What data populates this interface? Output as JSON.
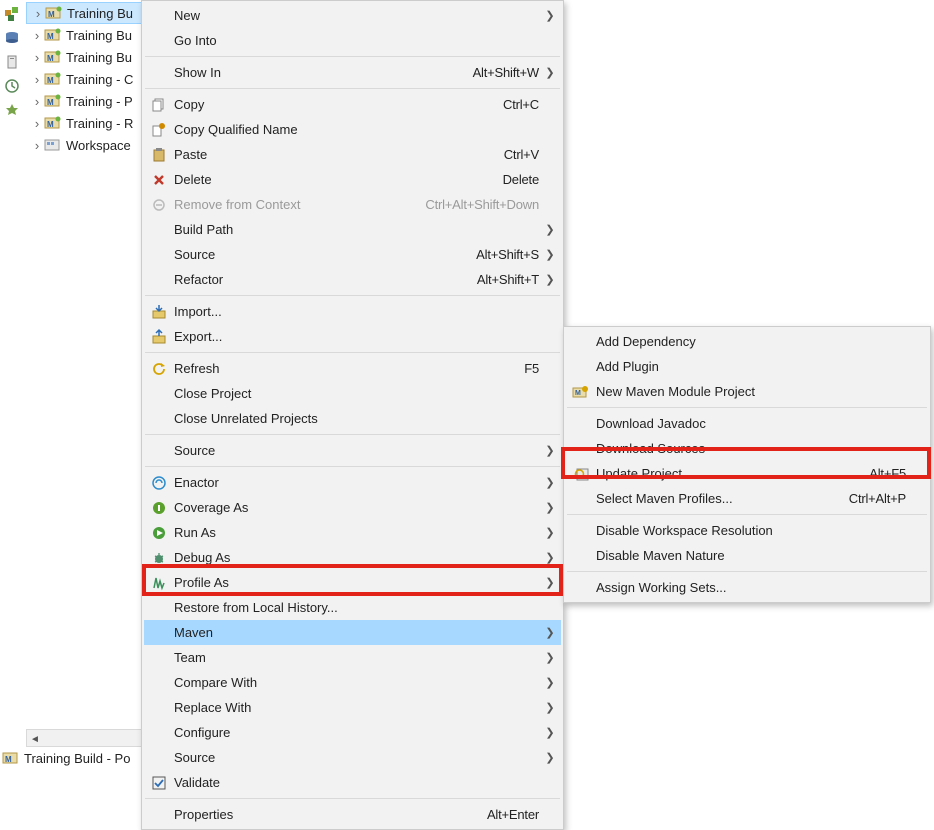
{
  "vstrip_icons": [
    "package-icon",
    "db-icon",
    "tag-icon",
    "history-icon",
    "star-icon"
  ],
  "tree": [
    {
      "label": "Training Bu",
      "selected": true
    },
    {
      "label": "Training Bu",
      "selected": false
    },
    {
      "label": "Training Bu",
      "selected": false
    },
    {
      "label": "Training - C",
      "selected": false
    },
    {
      "label": "Training - P",
      "selected": false
    },
    {
      "label": "Training - R",
      "selected": false
    },
    {
      "label": "Workspace",
      "selected": false
    }
  ],
  "status_text": "Training Build - Po",
  "menu1": {
    "groups": [
      [
        {
          "icon": null,
          "label": "New",
          "shortcut": "",
          "arrow": true
        },
        {
          "icon": null,
          "label": "Go Into",
          "shortcut": "",
          "arrow": false
        }
      ],
      [
        {
          "icon": null,
          "label": "Show In",
          "shortcut": "Alt+Shift+W",
          "arrow": true
        }
      ],
      [
        {
          "icon": "copy-icon",
          "label": "Copy",
          "shortcut": "Ctrl+C",
          "arrow": false
        },
        {
          "icon": "copy-qualified-icon",
          "label": "Copy Qualified Name",
          "shortcut": "",
          "arrow": false
        },
        {
          "icon": "paste-icon",
          "label": "Paste",
          "shortcut": "Ctrl+V",
          "arrow": false
        },
        {
          "icon": "delete-icon",
          "label": "Delete",
          "shortcut": "Delete",
          "arrow": false
        },
        {
          "icon": "context-icon",
          "label": "Remove from Context",
          "shortcut": "Ctrl+Alt+Shift+Down",
          "arrow": false,
          "disabled": true
        },
        {
          "icon": null,
          "label": "Build Path",
          "shortcut": "",
          "arrow": true
        },
        {
          "icon": null,
          "label": "Source",
          "shortcut": "Alt+Shift+S",
          "arrow": true
        },
        {
          "icon": null,
          "label": "Refactor",
          "shortcut": "Alt+Shift+T",
          "arrow": true
        }
      ],
      [
        {
          "icon": "import-icon",
          "label": "Import...",
          "shortcut": "",
          "arrow": false
        },
        {
          "icon": "export-icon",
          "label": "Export...",
          "shortcut": "",
          "arrow": false
        }
      ],
      [
        {
          "icon": "refresh-icon",
          "label": "Refresh",
          "shortcut": "F5",
          "arrow": false
        },
        {
          "icon": null,
          "label": "Close Project",
          "shortcut": "",
          "arrow": false
        },
        {
          "icon": null,
          "label": "Close Unrelated Projects",
          "shortcut": "",
          "arrow": false
        }
      ],
      [
        {
          "icon": null,
          "label": "Source",
          "shortcut": "",
          "arrow": true
        }
      ],
      [
        {
          "icon": "enactor-icon",
          "label": "Enactor",
          "shortcut": "",
          "arrow": true
        },
        {
          "icon": "coverage-icon",
          "label": "Coverage As",
          "shortcut": "",
          "arrow": true
        },
        {
          "icon": "run-icon",
          "label": "Run As",
          "shortcut": "",
          "arrow": true
        },
        {
          "icon": "debug-icon",
          "label": "Debug As",
          "shortcut": "",
          "arrow": true
        },
        {
          "icon": "profile-icon",
          "label": "Profile As",
          "shortcut": "",
          "arrow": true
        },
        {
          "icon": null,
          "label": "Restore from Local History...",
          "shortcut": "",
          "arrow": false
        },
        {
          "icon": null,
          "label": "Maven",
          "shortcut": "",
          "arrow": true,
          "hover": true
        },
        {
          "icon": null,
          "label": "Team",
          "shortcut": "",
          "arrow": true
        },
        {
          "icon": null,
          "label": "Compare With",
          "shortcut": "",
          "arrow": true
        },
        {
          "icon": null,
          "label": "Replace With",
          "shortcut": "",
          "arrow": true
        },
        {
          "icon": null,
          "label": "Configure",
          "shortcut": "",
          "arrow": true
        },
        {
          "icon": null,
          "label": "Source",
          "shortcut": "",
          "arrow": true
        },
        {
          "icon": "validate-icon",
          "label": "Validate",
          "shortcut": "",
          "arrow": false
        }
      ],
      [
        {
          "icon": null,
          "label": "Properties",
          "shortcut": "Alt+Enter",
          "arrow": false
        }
      ]
    ]
  },
  "submenu": [
    [
      {
        "icon": null,
        "label": "Add Dependency",
        "shortcut": "",
        "arrow": false
      },
      {
        "icon": null,
        "label": "Add Plugin",
        "shortcut": "",
        "arrow": false
      },
      {
        "icon": "maven-module-icon",
        "label": "New Maven Module Project",
        "shortcut": "",
        "arrow": false
      }
    ],
    [
      {
        "icon": null,
        "label": "Download Javadoc",
        "shortcut": "",
        "arrow": false
      },
      {
        "icon": null,
        "label": "Download Sources",
        "shortcut": "",
        "arrow": false
      },
      {
        "icon": "update-project-icon",
        "label": "Update Project...",
        "shortcut": "Alt+F5",
        "arrow": false
      },
      {
        "icon": null,
        "label": "Select Maven Profiles...",
        "shortcut": "Ctrl+Alt+P",
        "arrow": false
      }
    ],
    [
      {
        "icon": null,
        "label": "Disable Workspace Resolution",
        "shortcut": "",
        "arrow": false
      },
      {
        "icon": null,
        "label": "Disable Maven Nature",
        "shortcut": "",
        "arrow": false
      }
    ],
    [
      {
        "icon": null,
        "label": "Assign Working Sets...",
        "shortcut": "",
        "arrow": false
      }
    ]
  ]
}
